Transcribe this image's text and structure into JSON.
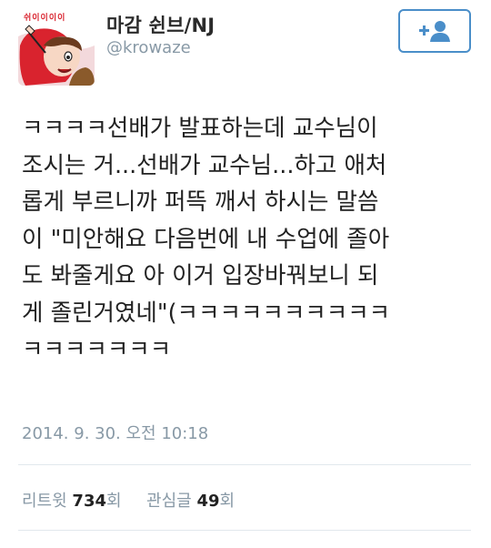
{
  "user": {
    "display_name": "마감 쉰브/NJ",
    "username": "@krowaze",
    "avatar_text": "쉬이이이이"
  },
  "follow_button": {
    "icon": "add-user-icon",
    "plus": "+"
  },
  "tweet": {
    "text": "ㅋㅋㅋㅋ선배가 발표하는데 교수님이\n조시는 거...선배가 교수님...하고 애처\n롭게 부르니까 퍼뜩 깨서 하시는 말씀\n이 \"미안해요 다음번에 내 수업에 졸아\n도 봐줄게요 아 이거 입장바꿔보니 되\n게 졸린거였네\"(ㅋㅋㅋㅋㅋㅋㅋㅋㅋㅋ\nㅋㅋㅋㅋㅋㅋㅋ",
    "timestamp": "2014. 9. 30. 오전 10:18"
  },
  "stats": {
    "retweet_label": "리트윗",
    "retweet_count": "734",
    "retweet_suffix": "회",
    "favorite_label": "관심글",
    "favorite_count": "49",
    "favorite_suffix": "회"
  },
  "colors": {
    "accent": "#4a8ec9",
    "muted": "#8899a6",
    "divider": "#e1e8ed",
    "avatar_red": "#d9232e"
  }
}
